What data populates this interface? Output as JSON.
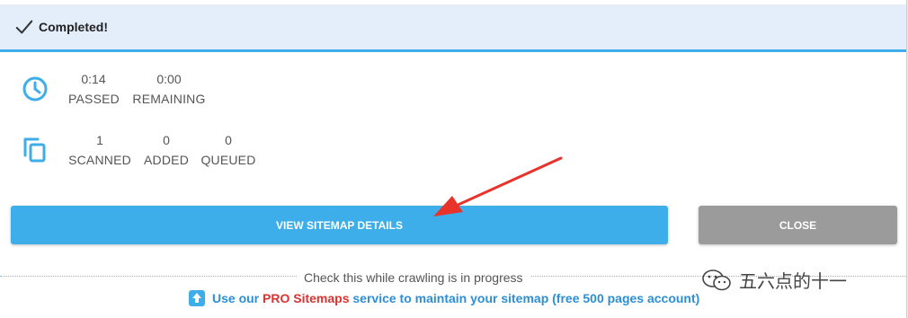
{
  "header": {
    "title": "Completed!",
    "icon": "checkmark-icon"
  },
  "time": {
    "icon": "clock-icon",
    "passed": {
      "value": "0:14",
      "label": "PASSED"
    },
    "remaining": {
      "value": "0:00",
      "label": "REMAINING"
    }
  },
  "pages": {
    "icon": "copy-pages-icon",
    "scanned": {
      "value": "1",
      "label": "SCANNED"
    },
    "added": {
      "value": "0",
      "label": "ADDED"
    },
    "queued": {
      "value": "0",
      "label": "QUEUED"
    }
  },
  "buttons": {
    "view_details": "VIEW SITEMAP DETAILS",
    "close": "CLOSE"
  },
  "footer": {
    "note": "Check this while crawling is in progress",
    "promo_prefix": "Use our ",
    "promo_highlight": "PRO Sitemaps",
    "promo_suffix": " service to maintain your sitemap (free 500 pages account)",
    "promo_icon": "upload-box-icon"
  },
  "watermark": {
    "text": "五六点的十一",
    "icon": "wechat-icon"
  },
  "colors": {
    "accent": "#3daeea",
    "header_bg": "#e3eefa",
    "close_bg": "#9b9b9b",
    "promo_blue": "#2c8fd6",
    "promo_red": "#d9332f",
    "arrow": "#e8322a"
  }
}
